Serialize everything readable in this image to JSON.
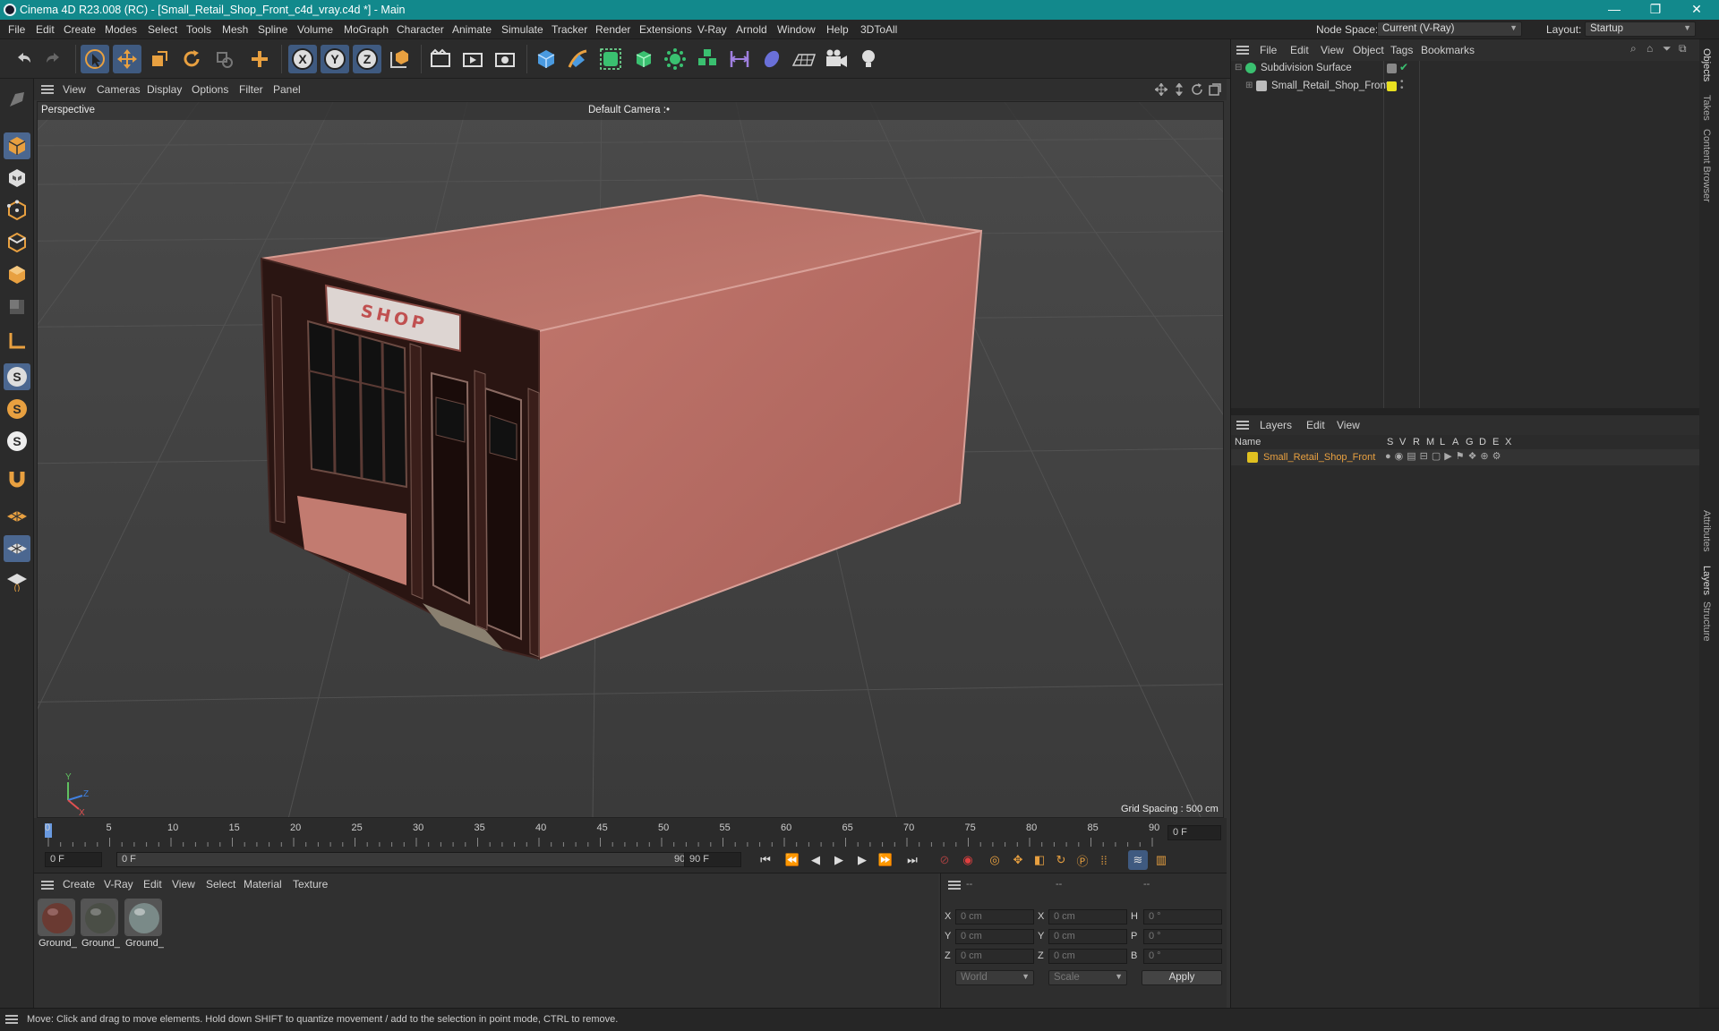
{
  "window": {
    "title": "Cinema 4D R23.008 (RC) - [Small_Retail_Shop_Front_c4d_vray.c4d *] - Main",
    "minimize": "—",
    "restore": "❐",
    "close": "✕"
  },
  "menu": [
    "File",
    "Edit",
    "Create",
    "Modes",
    "Select",
    "Tools",
    "Mesh",
    "Spline",
    "Volume",
    "MoGraph",
    "Character",
    "Animate",
    "Simulate",
    "Tracker",
    "Render",
    "Extensions",
    "V-Ray",
    "Arnold",
    "Window",
    "Help",
    "3DToAll"
  ],
  "node_space": {
    "label": "Node Space:",
    "value": "Current (V-Ray)"
  },
  "layout": {
    "label": "Layout:",
    "value": "Startup"
  },
  "toolbar": {
    "axis_x": "X",
    "axis_y": "Y",
    "axis_z": "Z",
    "icons": [
      "undo-icon",
      "redo-icon",
      "select-icon",
      "move-icon",
      "scale-icon",
      "rotate-icon",
      "recent-icon",
      "add-icon",
      "axis-x-icon",
      "axis-y-icon",
      "axis-z-icon",
      "coordinate-system-icon",
      "render-region-icon",
      "render-view-icon",
      "render-settings-icon",
      "cube-icon",
      "pen-icon",
      "subdivision-icon",
      "extrude-icon",
      "array-icon",
      "mograph-icon",
      "deformer-icon",
      "field-icon",
      "floor-icon",
      "camera-icon",
      "light-icon"
    ]
  },
  "viewport": {
    "menu": [
      "View",
      "Cameras",
      "Display",
      "Options",
      "Filter",
      "Panel"
    ],
    "projection": "Perspective",
    "camera": "Default Camera",
    "camera_mark": ":•",
    "grid_spacing": "Grid Spacing : 500 cm",
    "sign_text": "SHOP",
    "axis_labels": {
      "y": "Y",
      "z": "Z",
      "x": "X"
    }
  },
  "timeline": {
    "ticks": [
      "0",
      "5",
      "10",
      "15",
      "20",
      "25",
      "30",
      "35",
      "40",
      "45",
      "50",
      "55",
      "60",
      "65",
      "70",
      "75",
      "80",
      "85",
      "90"
    ],
    "current_frame": "0 F",
    "start": "0 F",
    "range_start": "0 F",
    "range_end": "90 F",
    "end": "90 F"
  },
  "materials": {
    "menu": [
      "Create",
      "V-Ray",
      "Edit",
      "View",
      "Select",
      "Material",
      "Texture"
    ],
    "items": [
      {
        "label": "Ground_",
        "color": "#6a3a32"
      },
      {
        "label": "Ground_",
        "color": "#4a4e46"
      },
      {
        "label": "Ground_",
        "color": "#7a8a88"
      }
    ]
  },
  "coords": {
    "headers": [
      "--",
      "--",
      "--"
    ],
    "rows": [
      {
        "a": "X",
        "av": "0 cm",
        "b": "X",
        "bv": "0 cm",
        "c": "H",
        "cv": "0 °"
      },
      {
        "a": "Y",
        "av": "0 cm",
        "b": "Y",
        "bv": "0 cm",
        "c": "P",
        "cv": "0 °"
      },
      {
        "a": "Z",
        "av": "0 cm",
        "b": "Z",
        "bv": "0 cm",
        "c": "B",
        "cv": "0 °"
      }
    ],
    "world": "World",
    "scale": "Scale",
    "apply": "Apply"
  },
  "objects": {
    "menu": [
      "File",
      "Edit",
      "View",
      "Object",
      "Tags",
      "Bookmarks"
    ],
    "items": [
      {
        "name": "Subdivision Surface",
        "color": "#2ecc40"
      },
      {
        "name": "Small_Retail_Shop_Front",
        "color": "#e8e020"
      }
    ]
  },
  "layers": {
    "menu": [
      "Layers",
      "Edit",
      "View"
    ],
    "columns": [
      "Name",
      "S",
      "V",
      "R",
      "M",
      "L",
      "A",
      "G",
      "D",
      "E",
      "X"
    ],
    "items": [
      {
        "name": "Small_Retail_Shop_Front",
        "color": "#e0c020"
      }
    ]
  },
  "side_tabs": [
    "Objects",
    "Takes",
    "Content Browser",
    "Attributes",
    "Layers",
    "Structure"
  ],
  "status": "Move: Click and drag to move elements. Hold down SHIFT to quantize movement / add to the selection in point mode, CTRL to remove."
}
